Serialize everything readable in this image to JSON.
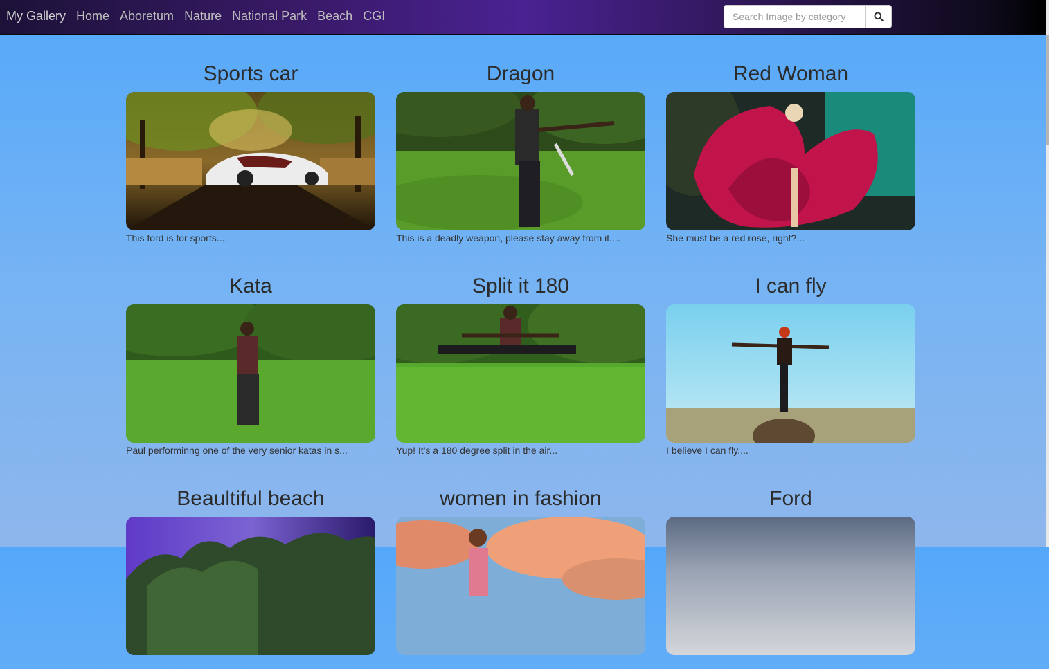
{
  "nav": {
    "brand": "My Gallery",
    "links": [
      "Home",
      "Aboretum",
      "Nature",
      "National Park",
      "Beach",
      "CGI"
    ],
    "search_placeholder": "Search Image by category"
  },
  "cards": [
    {
      "title": "Sports car",
      "caption": "This ford is for sports...."
    },
    {
      "title": "Dragon",
      "caption": "This is a deadly weapon, please stay away from it...."
    },
    {
      "title": "Red Woman",
      "caption": "She must be a red rose, right?..."
    },
    {
      "title": "Kata",
      "caption": "Paul performinng one of the very senior katas in s..."
    },
    {
      "title": "Split it 180",
      "caption": "Yup! It's a 180 degree split in the air..."
    },
    {
      "title": "I can fly",
      "caption": "I believe I can fly...."
    },
    {
      "title": "Beaultiful beach",
      "caption": ""
    },
    {
      "title": "women in fashion",
      "caption": ""
    },
    {
      "title": "Ford",
      "caption": ""
    }
  ]
}
